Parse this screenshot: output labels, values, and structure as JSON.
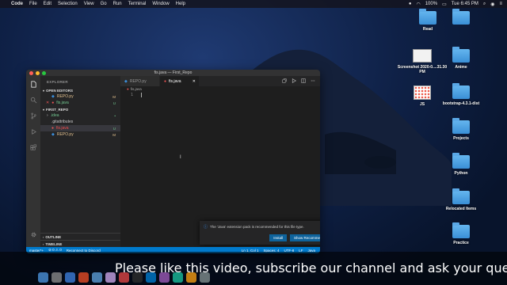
{
  "menubar": {
    "app_name": "Code",
    "menus": [
      "File",
      "Edit",
      "Selection",
      "View",
      "Go",
      "Run",
      "Terminal",
      "Window",
      "Help"
    ],
    "battery": "100%",
    "clock": "Tue 6:45 PM"
  },
  "desktop_icons": [
    {
      "label": "Read",
      "kind": "folder"
    },
    {
      "label": "",
      "kind": "folder"
    },
    {
      "label": "Screenshot 2020-0....31.30 PM",
      "kind": "thumb"
    },
    {
      "label": "Anime",
      "kind": "folder"
    },
    {
      "label": "JS",
      "kind": "thumb2"
    },
    {
      "label": "bootstrap-4.3.1-dist",
      "kind": "folder"
    },
    {
      "label": "Projects",
      "kind": "folder"
    },
    {
      "label": "Python",
      "kind": "folder"
    },
    {
      "label": "Relocated Items",
      "kind": "folder"
    },
    {
      "label": "Practice",
      "kind": "folder"
    }
  ],
  "window": {
    "title": "fis.java — First_Repo"
  },
  "sidebar": {
    "title": "EXPLORER",
    "open_editors": {
      "label": "OPEN EDITORS",
      "items": [
        {
          "name": "REPO.py",
          "status": "M",
          "color": "#e2c08d"
        },
        {
          "name": "fis.java",
          "status": "U",
          "color": "#73c991"
        }
      ]
    },
    "folder": {
      "label": "FIRST_REPO",
      "items": [
        {
          "name": ".idea",
          "status": "",
          "color": "#73c991"
        },
        {
          "name": ".gitattributes",
          "status": "",
          "color": "#cccccc"
        },
        {
          "name": "fis.java",
          "status": "U",
          "color": "#f14c4c"
        },
        {
          "name": "REPO.py",
          "status": "M",
          "color": "#e2c08d"
        }
      ]
    },
    "outline": "OUTLINE",
    "timeline": "TIMELINE"
  },
  "editor": {
    "tabs": [
      {
        "label": "REPO.py",
        "active": false
      },
      {
        "label": "fis.java",
        "active": true
      }
    ],
    "breadcrumb": "fis.java",
    "line_number": "1"
  },
  "notification": {
    "message": "The 'Java' extension pack is recommended for this file type.",
    "install_label": "Install",
    "recommend_label": "Show Recommendations"
  },
  "statusbar": {
    "branch": "master*+",
    "sync": "⊘ 0 ⚠ 0",
    "live": "Reconnect to Discord",
    "position": "Ln 1, Col 1",
    "spaces": "Spaces: 4",
    "encoding": "UTF-8",
    "eol": "LF",
    "language": "Java"
  },
  "subtitle": "Please like this video, subscribe our channel and ask your ques",
  "colors": {
    "accent": "#007acc",
    "button": "#0e639c"
  }
}
